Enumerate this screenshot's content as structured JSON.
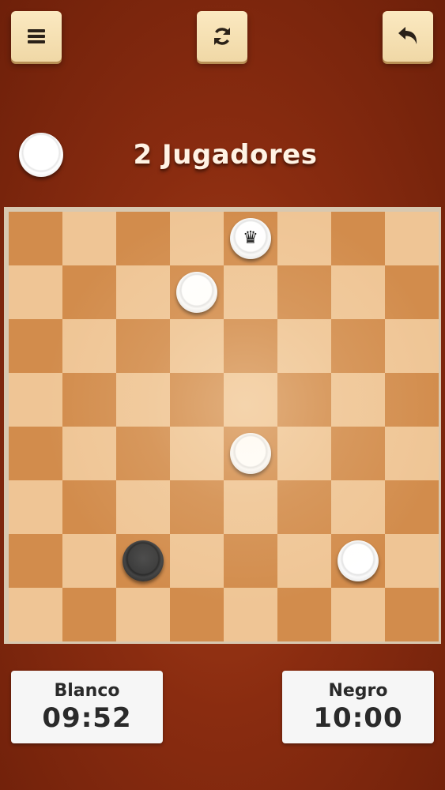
{
  "header": {
    "menu_icon": "menu-icon",
    "restart_icon": "restart-icon",
    "undo_icon": "undo-icon"
  },
  "title": "2 Jugadores",
  "current_turn": "white",
  "board": {
    "size": 8,
    "pieces": [
      {
        "row": 0,
        "col": 4,
        "color": "white",
        "king": true,
        "crown_glyph": "♛"
      },
      {
        "row": 1,
        "col": 3,
        "color": "white",
        "king": false
      },
      {
        "row": 4,
        "col": 4,
        "color": "white",
        "king": false
      },
      {
        "row": 6,
        "col": 2,
        "color": "black",
        "king": false
      },
      {
        "row": 6,
        "col": 6,
        "color": "white",
        "king": false
      }
    ]
  },
  "clocks": {
    "white": {
      "label": "Blanco",
      "time": "09:52"
    },
    "black": {
      "label": "Negro",
      "time": "10:00"
    }
  },
  "colors": {
    "dark_square": "#d28c4c",
    "light_square": "#efc595",
    "background": "#8a2c10",
    "button": "#f4deb0"
  }
}
